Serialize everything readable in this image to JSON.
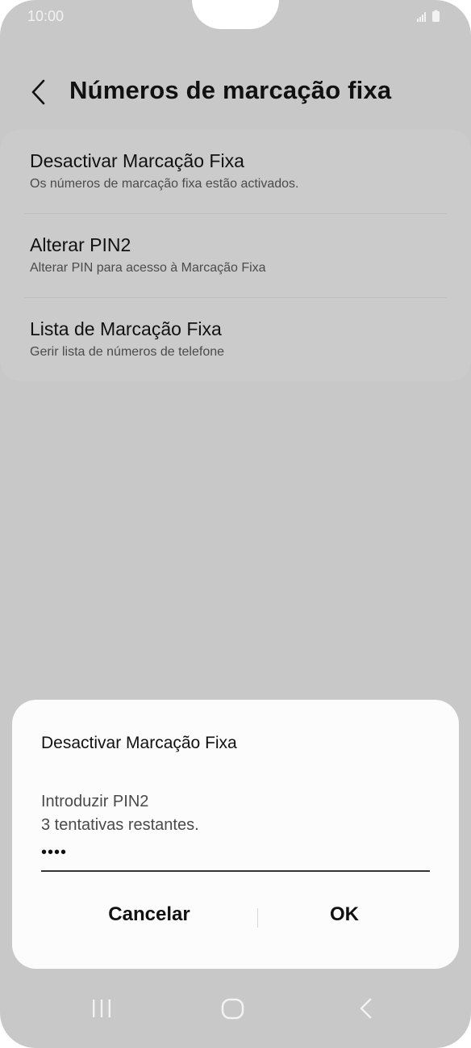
{
  "status_bar": {
    "time": "10:00",
    "signal_icon": "signal-icon",
    "battery_icon": "battery-icon"
  },
  "header": {
    "title": "Números de marcação fixa",
    "back_icon": "chevron-left-icon"
  },
  "menu": {
    "items": [
      {
        "title": "Desactivar Marcação Fixa",
        "subtitle": "Os números de marcação fixa estão activados."
      },
      {
        "title": "Alterar PIN2",
        "subtitle": "Alterar PIN para acesso à Marcação Fixa"
      },
      {
        "title": "Lista de Marcação Fixa",
        "subtitle": "Gerir lista de números de telefone"
      }
    ]
  },
  "dialog": {
    "title": "Desactivar Marcação Fixa",
    "prompt": "Introduzir PIN2",
    "attempts": "3 tentativas restantes.",
    "pin_value": "••••",
    "cancel_label": "Cancelar",
    "ok_label": "OK"
  },
  "nav_bar": {
    "recents_icon": "recents-icon",
    "home_icon": "home-icon",
    "back_icon": "back-icon"
  },
  "colors": {
    "background_dim": "#c8c8c8",
    "dialog_bg": "#fcfcfc",
    "text_primary": "#111111",
    "text_secondary": "#4b4b4b"
  }
}
